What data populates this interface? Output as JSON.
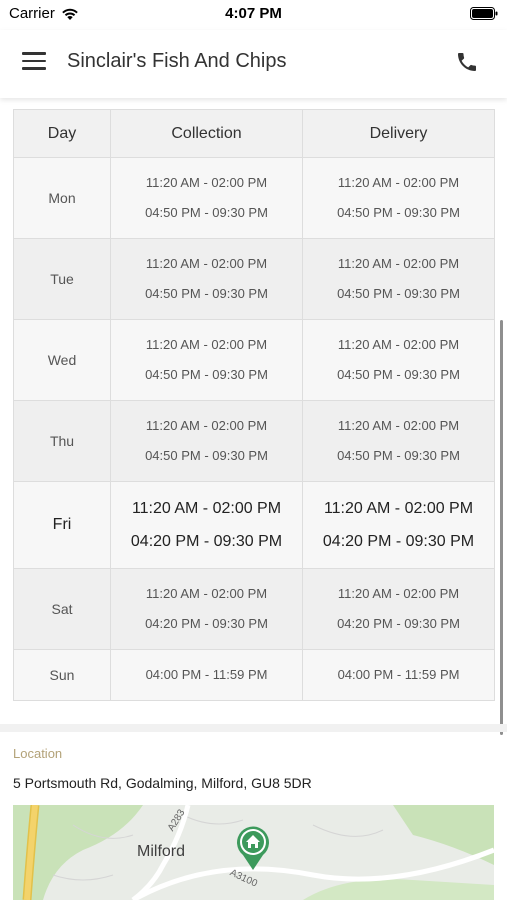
{
  "status_bar": {
    "carrier": "Carrier",
    "time": "4:07 PM"
  },
  "header": {
    "title": "Sinclair's Fish And Chips"
  },
  "hours": {
    "columns": [
      "Day",
      "Collection",
      "Delivery"
    ],
    "rows": [
      {
        "day": "Mon",
        "collection": [
          "11:20 AM - 02:00 PM",
          "04:50 PM - 09:30 PM"
        ],
        "delivery": [
          "11:20 AM - 02:00 PM",
          "04:50 PM - 09:30 PM"
        ]
      },
      {
        "day": "Tue",
        "collection": [
          "11:20 AM - 02:00 PM",
          "04:50 PM - 09:30 PM"
        ],
        "delivery": [
          "11:20 AM - 02:00 PM",
          "04:50 PM - 09:30 PM"
        ]
      },
      {
        "day": "Wed",
        "collection": [
          "11:20 AM - 02:00 PM",
          "04:50 PM - 09:30 PM"
        ],
        "delivery": [
          "11:20 AM - 02:00 PM",
          "04:50 PM - 09:30 PM"
        ]
      },
      {
        "day": "Thu",
        "collection": [
          "11:20 AM - 02:00 PM",
          "04:50 PM - 09:30 PM"
        ],
        "delivery": [
          "11:20 AM - 02:00 PM",
          "04:50 PM - 09:30 PM"
        ]
      },
      {
        "day": "Fri",
        "collection": [
          "11:20 AM - 02:00 PM",
          "04:20 PM - 09:30 PM"
        ],
        "delivery": [
          "11:20 AM - 02:00 PM",
          "04:20 PM - 09:30 PM"
        ]
      },
      {
        "day": "Sat",
        "collection": [
          "11:20 AM - 02:00 PM",
          "04:20 PM - 09:30 PM"
        ],
        "delivery": [
          "11:20 AM - 02:00 PM",
          "04:20 PM - 09:30 PM"
        ]
      },
      {
        "day": "Sun",
        "collection": [
          "04:00 PM - 11:59 PM"
        ],
        "delivery": [
          "04:00 PM - 11:59 PM"
        ]
      }
    ]
  },
  "location": {
    "label": "Location",
    "address": "5 Portsmouth Rd, Godalming, Milford, GU8 5DR"
  },
  "map": {
    "town": "Milford",
    "road_north": "A283",
    "road_south": "A3100"
  },
  "colors": {
    "accent_label": "#b3a278",
    "map_pin": "#3d9a5c",
    "map_green": "#c9e2b8",
    "road_yellow": "#f3d36b"
  }
}
